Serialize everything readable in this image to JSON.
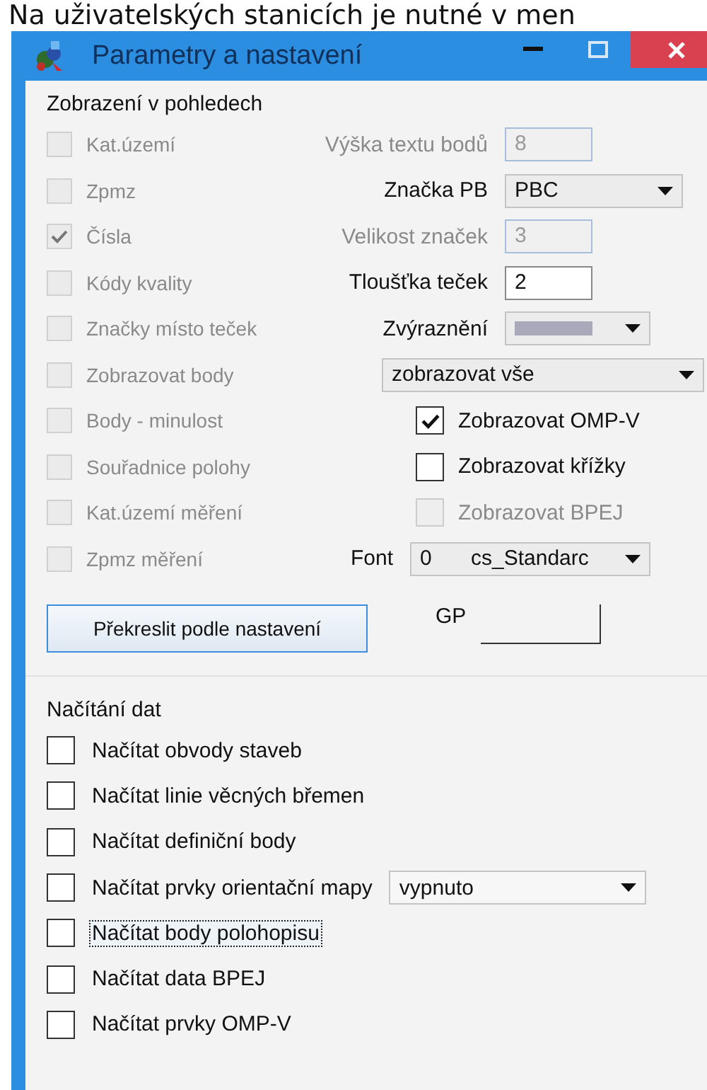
{
  "caption": "Na uživatelských stanicích je nutné v men",
  "window": {
    "title": "Parametry a nastavení"
  },
  "display": {
    "title": "Zobrazení v pohledech",
    "rows": [
      {
        "option": {
          "label": "Kat.území",
          "checked": false,
          "disabled": true
        },
        "control": {
          "kind": "input",
          "label": "Výška textu bodů",
          "value": "8",
          "disabled": true
        }
      },
      {
        "option": {
          "label": "Zpmz",
          "checked": false,
          "disabled": true
        },
        "control": {
          "kind": "select",
          "label": "Značka PB",
          "value": "PBC",
          "disabled": false
        }
      },
      {
        "option": {
          "label": "Čísla",
          "checked": true,
          "disabled": true
        },
        "control": {
          "kind": "input",
          "label": "Velikost značek",
          "value": "3",
          "disabled": true
        }
      },
      {
        "option": {
          "label": "Kódy kvality",
          "checked": false,
          "disabled": true
        },
        "control": {
          "kind": "input",
          "label": "Tloušťka teček",
          "value": "2",
          "disabled": false
        }
      },
      {
        "option": {
          "label": "Značky místo teček",
          "checked": false,
          "disabled": true
        },
        "control": {
          "kind": "swatch",
          "label": "Zvýraznění",
          "color": "#a9a9bb",
          "disabled": false
        }
      },
      {
        "option": {
          "label": "Zobrazovat body",
          "checked": false,
          "disabled": true
        },
        "control": {
          "kind": "wide-select",
          "value": "zobrazovat vše",
          "disabled": false
        }
      },
      {
        "option": {
          "label": "Body - minulost",
          "checked": false,
          "disabled": true
        },
        "control": {
          "kind": "checkbox",
          "label": "Zobrazovat OMP-V",
          "checked": true,
          "disabled": false
        }
      },
      {
        "option": {
          "label": "Souřadnice polohy",
          "checked": false,
          "disabled": true
        },
        "control": {
          "kind": "checkbox",
          "label": "Zobrazovat křížky",
          "checked": false,
          "disabled": false
        }
      },
      {
        "option": {
          "label": "Kat.území měření",
          "checked": false,
          "disabled": true
        },
        "control": {
          "kind": "checkbox",
          "label": "Zobrazovat BPEJ",
          "checked": false,
          "disabled": true
        }
      },
      {
        "option": {
          "label": "Zpmz měření",
          "checked": false,
          "disabled": true
        },
        "control": {
          "kind": "font",
          "label": "Font",
          "number": "0",
          "value": "cs_Standarc",
          "disabled": false
        }
      }
    ],
    "redraw_button": "Překreslit podle nastavení",
    "gp": {
      "label": "GP"
    }
  },
  "loading": {
    "title": "Načítání dat",
    "items": [
      {
        "label": "Načítat obvody staveb",
        "checked": false,
        "focused": false
      },
      {
        "label": "Načítat linie věcných břemen",
        "checked": false,
        "focused": false
      },
      {
        "label": "Načítat definiční body",
        "checked": false,
        "focused": false
      },
      {
        "label": "Načítat prvky orientační mapy",
        "checked": false,
        "focused": false,
        "select": "vypnuto"
      },
      {
        "label": "Načítat body polohopisu",
        "checked": false,
        "focused": true
      },
      {
        "label": "Načítat data BPEJ",
        "checked": false,
        "focused": false
      },
      {
        "label": "Načítat prvky OMP-V",
        "checked": false,
        "focused": false
      }
    ]
  }
}
